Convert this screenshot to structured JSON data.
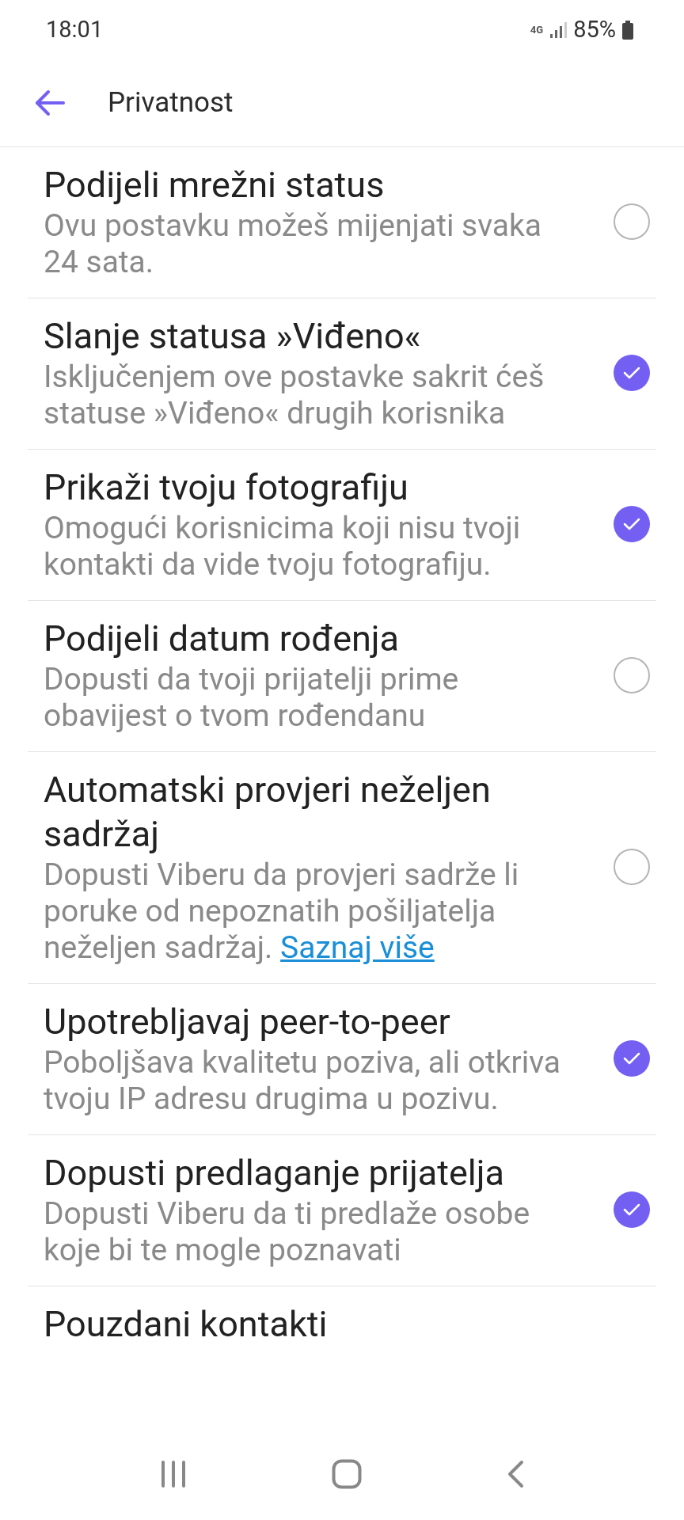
{
  "status_bar": {
    "time": "18:01",
    "network": "4G",
    "battery": "85%"
  },
  "header": {
    "title": "Privatnost"
  },
  "settings": [
    {
      "title": "Podijeli mrežni status",
      "description": "Ovu postavku možeš mijenjati svaka 24 sata.",
      "checked": false
    },
    {
      "title": "Slanje statusa »Viđeno«",
      "description": "Isključenjem ove postavke sakrit ćeš statuse »Viđeno« drugih korisnika",
      "checked": true
    },
    {
      "title": "Prikaži tvoju fotografiju",
      "description": "Omogući korisnicima koji nisu tvoji kontakti da vide tvoju fotografiju.",
      "checked": true
    },
    {
      "title": "Podijeli datum rođenja",
      "description": "Dopusti da tvoji prijatelji prime obavijest o tvom rođendanu",
      "checked": false
    },
    {
      "title": "Automatski provjeri neželjen sadržaj",
      "description": "Dopusti Viberu da provjeri sadrže li poruke od nepoznatih pošiljatelja neželjen sadržaj.",
      "link": "Saznaj više",
      "checked": false
    },
    {
      "title": "Upotrebljavaj peer-to-peer",
      "description": "Poboljšava kvalitetu poziva, ali otkriva tvoju IP adresu drugima u pozivu.",
      "checked": true
    },
    {
      "title": "Dopusti predlaganje prijatelja",
      "description": "Dopusti Viberu da ti predlaže osobe koje bi te mogle poznavati",
      "checked": true
    },
    {
      "title": "Pouzdani kontakti"
    }
  ]
}
